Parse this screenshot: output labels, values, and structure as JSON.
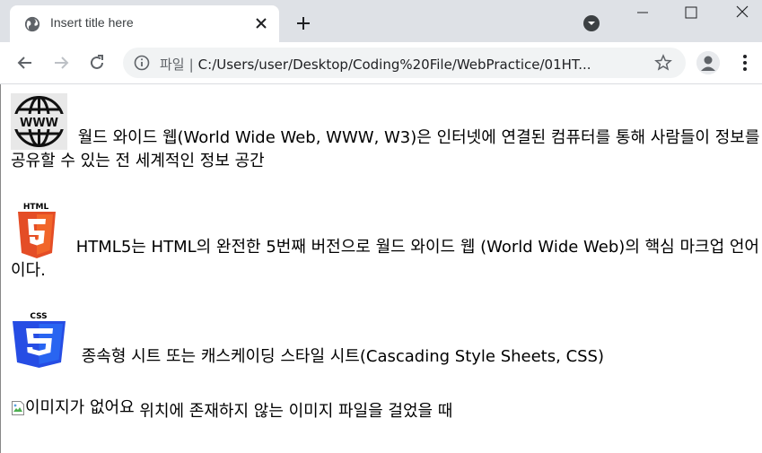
{
  "browser": {
    "tab": {
      "title": "Insert title here"
    },
    "address": {
      "scheme_label": "파일",
      "url": "C:/Users/user/Desktop/Coding%20File/WebPractice/01HT..."
    }
  },
  "content": {
    "paragraphs": [
      {
        "text": "월드 와이드 웹(World Wide Web, WWW, W3)은 인터넷에 연결된 컴퓨터를 통해 사람들이 정보를 공유할 수 있는 전 세계적인 정보 공간"
      },
      {
        "logo_text": "HTML",
        "text": "HTML5는 HTML의 완전한 5번째 버전으로 월드 와이드 웹 (World Wide Web)의 핵심 마크업 언어이다."
      },
      {
        "logo_text": "CSS",
        "text": "종속형 시트 또는 캐스케이딩 스타일 시트(Cascading Style Sheets, CSS)"
      }
    ],
    "broken_image": {
      "alt": "이미지가 없어요",
      "text": "위치에 존재하지 않는 이미지 파일을 걸었을 때"
    }
  },
  "colors": {
    "tabstrip": "#dee1e6",
    "html5_orange": "#e44d26",
    "css3_blue": "#264de4"
  },
  "icons": [
    "globe-icon",
    "close-icon",
    "plus-icon",
    "tab-search-icon",
    "minimize-icon",
    "maximize-icon",
    "window-close-icon",
    "back-icon",
    "forward-icon",
    "reload-icon",
    "info-icon",
    "star-icon",
    "profile-icon",
    "menu-icon",
    "www-globe-icon",
    "html5-logo",
    "css3-logo",
    "broken-image-icon"
  ]
}
